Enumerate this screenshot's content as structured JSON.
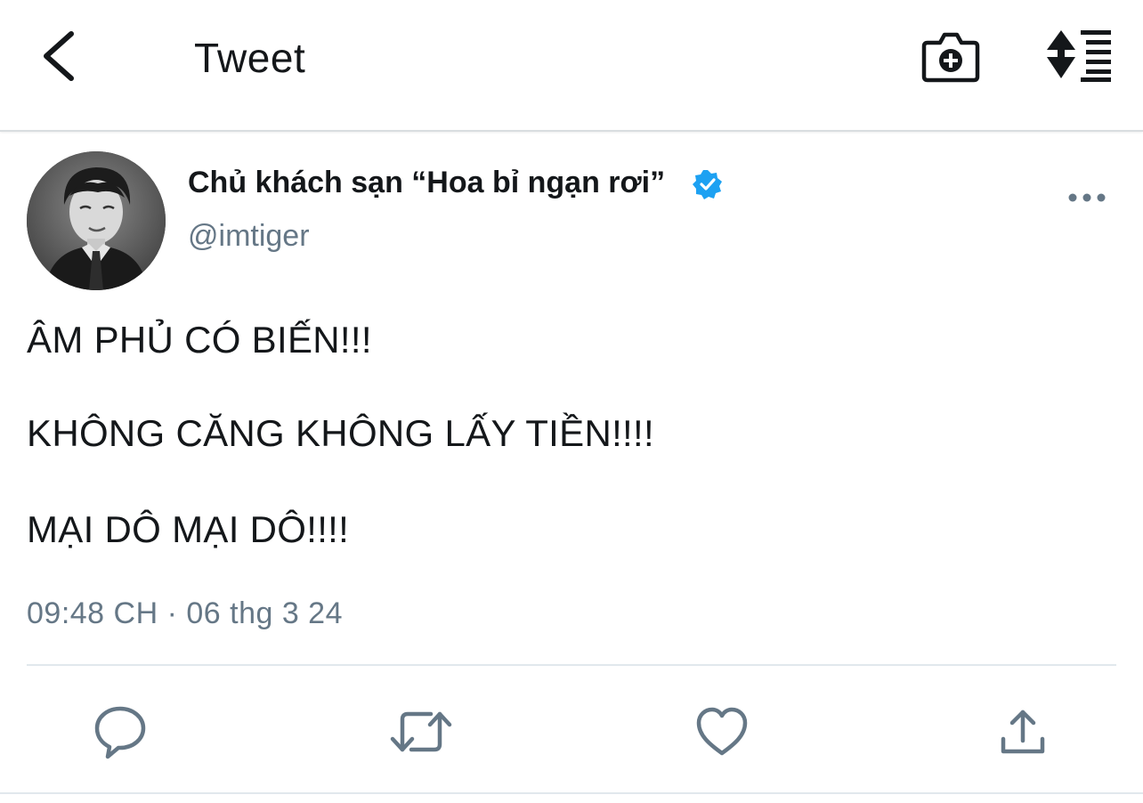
{
  "header": {
    "title": "Tweet",
    "back_icon": "chevron-left-icon",
    "camera_icon": "camera-add-icon",
    "sort_icon": "sort-list-icon"
  },
  "author": {
    "name": "Chủ khách sạn “Hoa bỉ ngạn rơi”",
    "handle": "@imtiger",
    "verified": true,
    "verified_color": "#1DA1F2"
  },
  "tweet": {
    "lines": [
      "ÂM PHỦ CÓ BIẾN!!!",
      "KHÔNG CĂNG KHÔNG LẤY TIỀN!!!!",
      "MẠI DÔ MẠI DÔ!!!!"
    ],
    "timestamp": "09:48 CH · 06 thg 3 24"
  },
  "actions": [
    {
      "icon": "reply-icon"
    },
    {
      "icon": "retweet-icon"
    },
    {
      "icon": "like-heart-icon"
    },
    {
      "icon": "share-icon"
    }
  ],
  "colors": {
    "text": "#14171A",
    "secondary": "#657786",
    "divider": "#E1E8ED"
  }
}
